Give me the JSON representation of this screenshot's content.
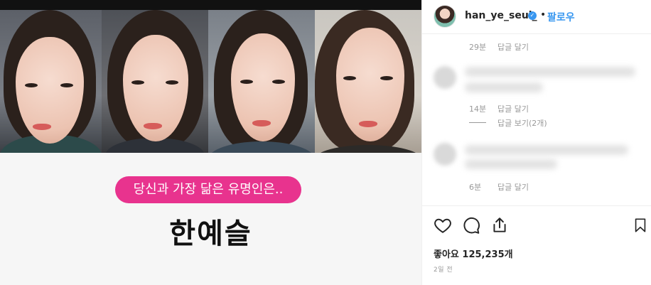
{
  "post": {
    "banner_text": "당신과 가장 닮은 유명인은..",
    "celebrity_name": "한예슬"
  },
  "header": {
    "username": "han_ye_seul_",
    "verified_icon": "verified-check-icon",
    "separator": "•",
    "follow_label": "팔로우"
  },
  "comments": [
    {
      "time": "29분",
      "reply_label": "답글 달기"
    },
    {
      "time": "14분",
      "reply_label": "답글 달기",
      "view_replies": "답글 보기(2개)"
    },
    {
      "time": "6분",
      "reply_label": "답글 달기"
    }
  ],
  "actions": {
    "icons": [
      "heart-icon",
      "comment-icon",
      "share-icon",
      "bookmark-icon"
    ],
    "likes": "좋아요 125,235개",
    "time": "2일 전"
  },
  "colors": {
    "accent_pink": "#e8338e",
    "link_blue": "#3897f0"
  }
}
